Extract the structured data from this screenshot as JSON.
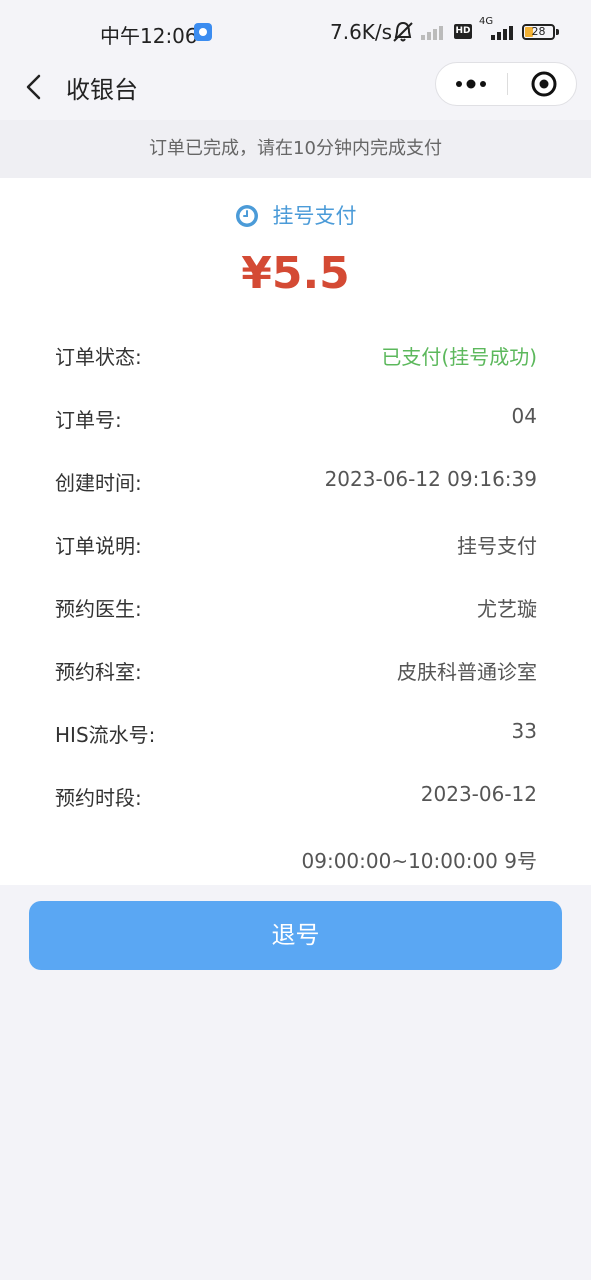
{
  "status_bar": {
    "time": "中午12:06",
    "speed": "7.6K/s",
    "hd": "HD",
    "network": "4G",
    "battery": "28"
  },
  "nav": {
    "title": "收银台"
  },
  "notice": "订单已完成，请在10分钟内完成支付",
  "payment": {
    "type": "挂号支付",
    "amount": "¥5.5"
  },
  "details": [
    {
      "label": "订单状态:",
      "value": "已支付(挂号成功)"
    },
    {
      "label": "订单号:",
      "value": "04"
    },
    {
      "label": "创建时间:",
      "value": "2023-06-12 09:16:39"
    },
    {
      "label": "订单说明:",
      "value": "挂号支付"
    },
    {
      "label": "预约医生:",
      "value": "尤艺璇"
    },
    {
      "label": "预约科室:",
      "value": "皮肤科普通诊室"
    },
    {
      "label": "HIS流水号:",
      "value": "33"
    },
    {
      "label": "预约时段:",
      "value": "2023-06-12"
    },
    {
      "label": "",
      "value": "09:00:00~10:00:00 9号"
    }
  ],
  "refund_button": "退号",
  "colors": {
    "accent_blue": "#5aa7f3",
    "amount_red": "#d44a34",
    "status_green": "#5cb85c"
  }
}
